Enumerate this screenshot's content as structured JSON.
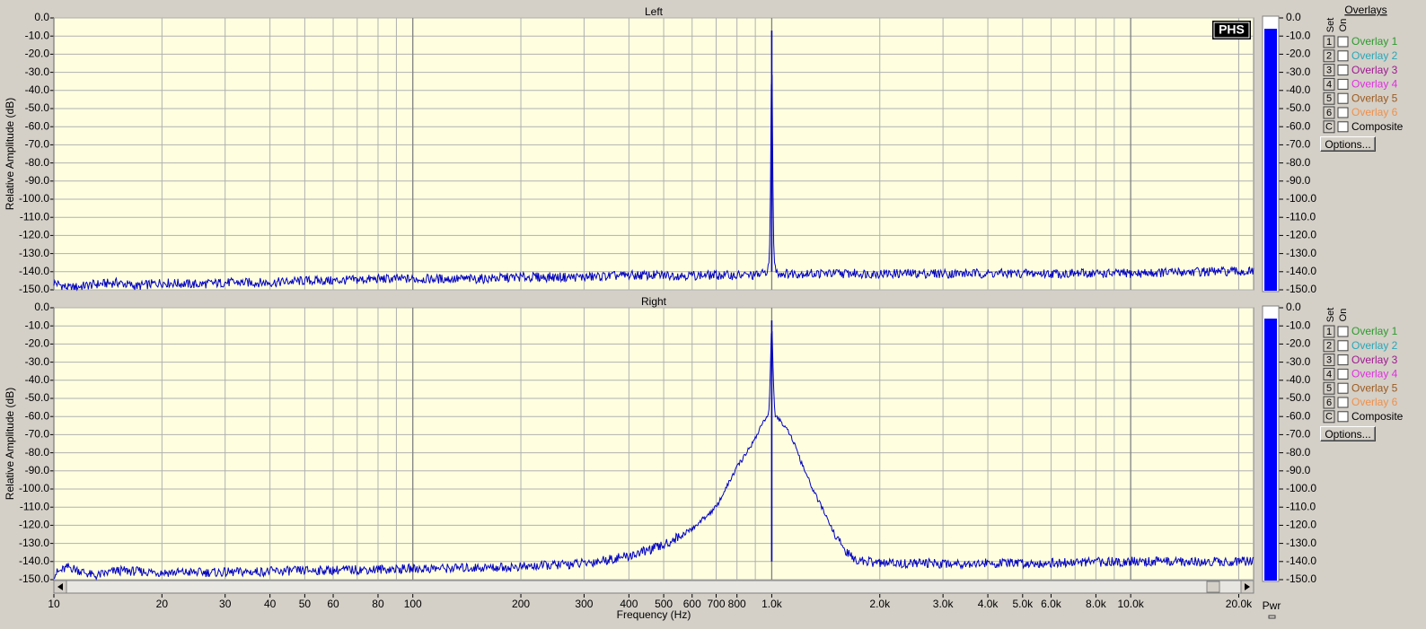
{
  "logo": "PHS",
  "overlays_title": "Overlays",
  "set_label": "Set",
  "on_label": "On",
  "options_label": "Options...",
  "overlays": [
    {
      "key": "1",
      "label": "Overlay 1",
      "color": "#2e9a2e"
    },
    {
      "key": "2",
      "label": "Overlay 2",
      "color": "#28a8b8"
    },
    {
      "key": "3",
      "label": "Overlay 3",
      "color": "#a01890"
    },
    {
      "key": "4",
      "label": "Overlay 4",
      "color": "#e030e0"
    },
    {
      "key": "5",
      "label": "Overlay 5",
      "color": "#9a5a20"
    },
    {
      "key": "6",
      "label": "Overlay 6",
      "color": "#f0904a"
    },
    {
      "key": "C",
      "label": "Composite",
      "color": "#000000"
    }
  ],
  "pwr_label": "Pwr",
  "colors": {
    "plot_bg": "#ffffe0",
    "trace": "#0000c0",
    "meter": "#0000ff",
    "grid": "#a0a0a0"
  },
  "chart_data": [
    {
      "type": "line",
      "title": "Left",
      "xlabel": "Frequency (Hz)",
      "ylabel": "Relative Amplitude (dB)",
      "xscale": "log",
      "xlim": [
        10,
        22000
      ],
      "ylim": [
        -150,
        0
      ],
      "yticks": [
        "0.0",
        "-10.0",
        "-20.0",
        "-30.0",
        "-40.0",
        "-50.0",
        "-60.0",
        "-70.0",
        "-80.0",
        "-90.0",
        "-100.0",
        "-110.0",
        "-120.0",
        "-130.0",
        "-140.0",
        "-150.0"
      ],
      "grid": true,
      "series": [
        {
          "x": [
            10,
            11,
            13,
            15,
            17,
            20,
            25,
            30,
            40,
            50,
            60,
            80,
            100,
            150,
            200,
            300,
            400,
            500,
            600,
            700,
            800,
            900,
            950,
            980,
            990,
            995,
            1000,
            1005,
            1010,
            1020,
            1050,
            1100,
            1200,
            1500,
            2000,
            3000,
            4000,
            5000,
            7000,
            10000,
            15000,
            20000,
            22000
          ],
          "y": [
            -146,
            -149,
            -147,
            -146,
            -148,
            -146,
            -147,
            -146,
            -146,
            -145,
            -145,
            -144,
            -144,
            -144,
            -143,
            -143,
            -142,
            -142,
            -142,
            -142,
            -142,
            -142,
            -141,
            -138,
            -120,
            -60,
            -7,
            -60,
            -120,
            -138,
            -141,
            -141,
            -141,
            -141,
            -141,
            -141,
            -141,
            -141,
            -141,
            -141,
            -140,
            -140,
            -140
          ]
        }
      ],
      "meter": {
        "level": -6
      }
    },
    {
      "type": "line",
      "title": "Right",
      "xlabel": "Frequency (Hz)",
      "ylabel": "Relative Amplitude (dB)",
      "xscale": "log",
      "xlim": [
        10,
        22000
      ],
      "ylim": [
        -150,
        0
      ],
      "yticks": [
        "0.0",
        "-10.0",
        "-20.0",
        "-30.0",
        "-40.0",
        "-50.0",
        "-60.0",
        "-70.0",
        "-80.0",
        "-90.0",
        "-100.0",
        "-110.0",
        "-120.0",
        "-130.0",
        "-140.0",
        "-150.0"
      ],
      "xticks": [
        "10",
        "20",
        "30",
        "40",
        "50",
        "60",
        "80",
        "100",
        "200",
        "300",
        "400",
        "500",
        "600",
        "700",
        "800",
        "1.0k",
        "2.0k",
        "3.0k",
        "4.0k",
        "5.0k",
        "6.0k",
        "8.0k",
        "10.0k",
        "20.0k"
      ],
      "grid": true,
      "series": [
        {
          "x": [
            10,
            11,
            13,
            15,
            20,
            30,
            50,
            100,
            200,
            300,
            400,
            500,
            600,
            700,
            800,
            850,
            900,
            950,
            980,
            990,
            995,
            1000,
            1005,
            1010,
            1020,
            1050,
            1100,
            1150,
            1200,
            1300,
            1400,
            1500,
            1600,
            1700,
            2000,
            3000,
            5000,
            10000,
            20000,
            22000
          ],
          "y": [
            -147,
            -143,
            -148,
            -145,
            -146,
            -146,
            -145,
            -144,
            -143,
            -141,
            -137,
            -131,
            -122,
            -110,
            -88,
            -80,
            -72,
            -62,
            -60,
            -40,
            -20,
            -7,
            -20,
            -40,
            -60,
            -62,
            -66,
            -74,
            -84,
            -100,
            -113,
            -125,
            -134,
            -139,
            -141,
            -141,
            -141,
            -140,
            -140,
            -140
          ]
        }
      ],
      "meter": {
        "level": -6
      }
    }
  ]
}
